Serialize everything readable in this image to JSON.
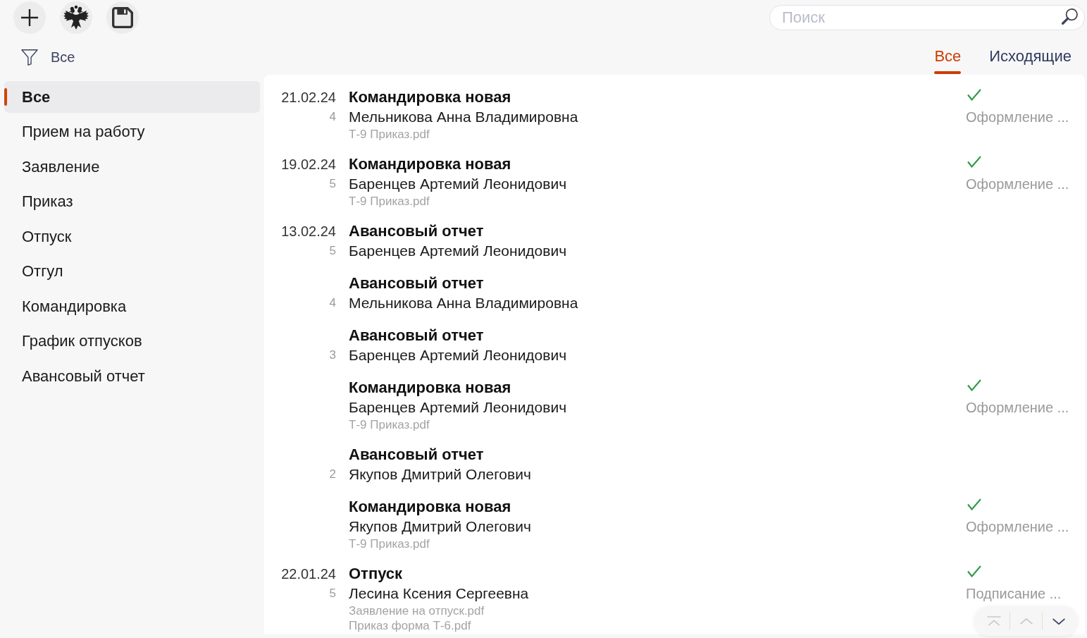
{
  "filter": {
    "label": "Все"
  },
  "search": {
    "placeholder": "Поиск"
  },
  "tabs": [
    {
      "label": "Все",
      "selected": true
    },
    {
      "label": "Исходящие",
      "selected": false
    }
  ],
  "sidebar": {
    "items": [
      {
        "label": "Все",
        "selected": true
      },
      {
        "label": "Прием на работу",
        "selected": false
      },
      {
        "label": "Заявление",
        "selected": false
      },
      {
        "label": "Приказ",
        "selected": false
      },
      {
        "label": "Отпуск",
        "selected": false
      },
      {
        "label": "Отгул",
        "selected": false
      },
      {
        "label": "Командировка",
        "selected": false
      },
      {
        "label": "График отпусков",
        "selected": false
      },
      {
        "label": "Авансовый отчет",
        "selected": false
      }
    ]
  },
  "documents": [
    {
      "date": "21.02.24",
      "title": "Командировка новая",
      "number": "4",
      "person": "Мельникова Анна Владимировна",
      "files": [
        "Т-9 Приказ.pdf"
      ],
      "checked": true,
      "status": "Оформление ..."
    },
    {
      "date": "19.02.24",
      "title": "Командировка новая",
      "number": "5",
      "person": "Баренцев Артемий Леонидович",
      "files": [
        "Т-9 Приказ.pdf"
      ],
      "checked": true,
      "status": "Оформление ..."
    },
    {
      "date": "13.02.24",
      "title": "Авансовый отчет",
      "number": "5",
      "person": "Баренцев Артемий Леонидович",
      "checked": false
    },
    {
      "title": "Авансовый отчет",
      "number": "4",
      "person": "Мельникова Анна Владимировна",
      "checked": false
    },
    {
      "title": "Авансовый отчет",
      "number": "3",
      "person": "Баренцев Артемий Леонидович",
      "checked": false
    },
    {
      "title": "Командировка новая",
      "person": "Баренцев Артемий Леонидович",
      "files": [
        "Т-9 Приказ.pdf"
      ],
      "checked": true,
      "status": "Оформление ..."
    },
    {
      "title": "Авансовый отчет",
      "number": "2",
      "person": "Якупов Дмитрий Олегович",
      "checked": false
    },
    {
      "title": "Командировка новая",
      "person": "Якупов Дмитрий Олегович",
      "files": [
        "Т-9 Приказ.pdf"
      ],
      "checked": true,
      "status": "Оформление ..."
    },
    {
      "date": "22.01.24",
      "title": "Отпуск",
      "number": "5",
      "person": "Лесина Ксения Сергеевна",
      "files": [
        "Заявление на отпуск.pdf",
        "Приказ форма Т-6.pdf"
      ],
      "checked": true,
      "status": "Подписание ..."
    }
  ],
  "scroll_controls": [
    {
      "kind": "top",
      "disabled": true
    },
    {
      "kind": "up",
      "disabled": true
    },
    {
      "kind": "down",
      "disabled": false
    }
  ]
}
